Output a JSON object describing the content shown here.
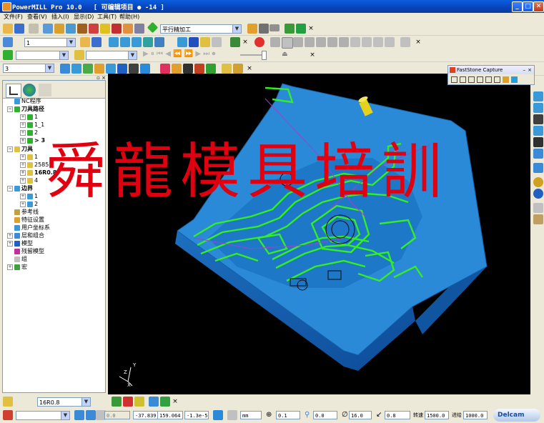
{
  "window": {
    "title": "PowerMILL Pro 10.0   [ 可编辑项目 ● -14 ]"
  },
  "menu": [
    "文件(F)",
    "查看(V)",
    "插入(I)",
    "显示(D)",
    "工具(T)",
    "帮助(H)"
  ],
  "toolbar1": {
    "toolpath_combo": "平行精加工"
  },
  "toolbar2": {
    "combo": "1"
  },
  "toolbar4": {
    "combo": "3"
  },
  "explorer": {
    "items": [
      {
        "label": "NC程序",
        "bold": false
      },
      {
        "label": "刀具路径",
        "bold": true
      },
      {
        "label": "1",
        "bold": false
      },
      {
        "label": "1_1",
        "bold": false
      },
      {
        "label": "2",
        "bold": false
      },
      {
        "label": "> 3",
        "bold": true
      },
      {
        "label": "刀具",
        "bold": true
      },
      {
        "label": "1",
        "bold": false
      },
      {
        "label": "2585",
        "bold": false
      },
      {
        "label": "16R0.8",
        "bold": true
      },
      {
        "label": "4",
        "bold": false
      },
      {
        "label": "边界",
        "bold": true
      },
      {
        "label": "1",
        "bold": false
      },
      {
        "label": "2",
        "bold": false
      },
      {
        "label": "参考线",
        "bold": false
      },
      {
        "label": "特征设置",
        "bold": false
      },
      {
        "label": "用户坐标系",
        "bold": false
      },
      {
        "label": "层和组合",
        "bold": false
      },
      {
        "label": "模型",
        "bold": false
      },
      {
        "label": "残留模型",
        "bold": false
      },
      {
        "label": "组",
        "bold": false
      },
      {
        "label": "宏",
        "bold": false
      }
    ]
  },
  "watermark": "舜龍模具培訓",
  "axis": {
    "z": "Z",
    "y": "Y",
    "x": "X"
  },
  "fastcapture": {
    "title": "FastStone Capture"
  },
  "status1": {
    "tool_combo": "16R0.8"
  },
  "status2": {
    "field0": "0.0",
    "x": "-37.839",
    "y": "159.064",
    "z": "-1.3e-5",
    "units": "mm",
    "tol": "0.1",
    "thickness": "0.0",
    "dia": "16.0",
    "stepover": "0.8",
    "speed_label": "转速",
    "speed": "1500.0",
    "feed_label": "进给",
    "feed": "1000.0",
    "brand": "Delcam"
  },
  "colors": {
    "model_blue": "#2a8ad8",
    "toolpath_green": "#33ee22",
    "watermark_red": "#e00010"
  }
}
